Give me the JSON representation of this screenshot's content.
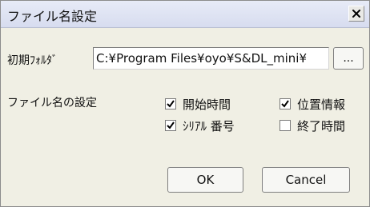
{
  "window": {
    "title": "ファイル名設定",
    "close_icon": "close-icon"
  },
  "folder": {
    "label": "初期ﾌｫﾙﾀﾞ",
    "value": "C:¥Program Files¥oyo¥S&DL_mini¥",
    "browse_label": "..."
  },
  "filename_settings": {
    "label": "ファイル名の設定",
    "options": [
      {
        "label": "開始時間",
        "checked": true
      },
      {
        "label": "位置情報",
        "checked": true
      },
      {
        "label": "ｼﾘｱﾙ 番号",
        "checked": true
      },
      {
        "label": "終了時間",
        "checked": false
      }
    ]
  },
  "buttons": {
    "ok": "OK",
    "cancel": "Cancel"
  }
}
